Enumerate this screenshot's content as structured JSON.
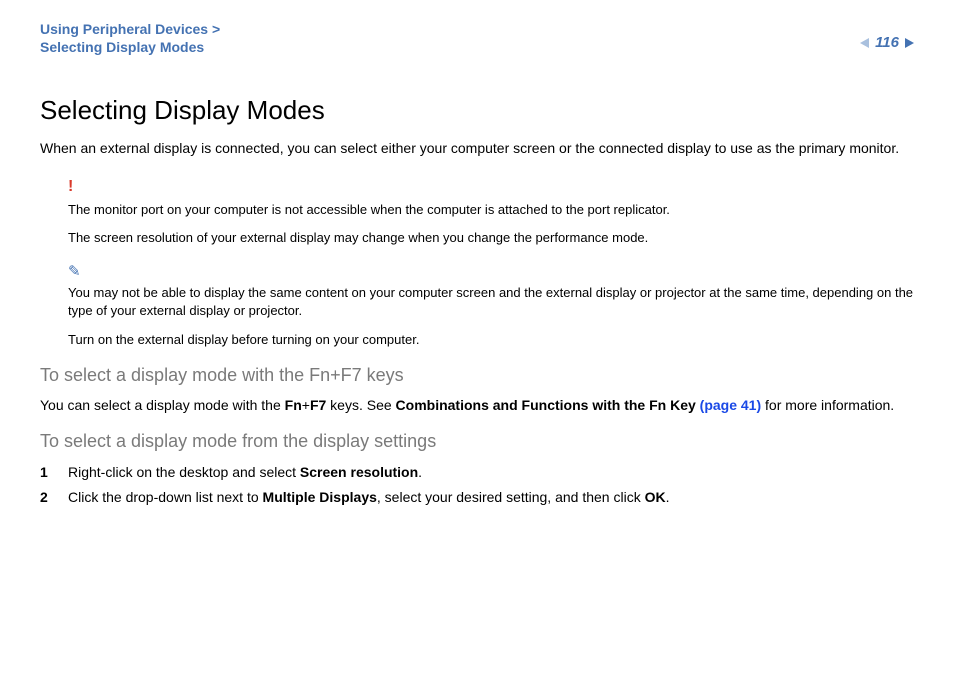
{
  "breadcrumb": {
    "line1": "Using Peripheral Devices >",
    "line2": "Selecting Display Modes"
  },
  "pageNumber": "116",
  "title": "Selecting Display Modes",
  "intro": "When an external display is connected, you can select either your computer screen or the connected display to use as the primary monitor.",
  "caution": {
    "p1": "The monitor port on your computer is not accessible when the computer is attached to the port replicator.",
    "p2": "The screen resolution of your external display may change when you change the performance mode."
  },
  "tip": {
    "p1": "You may not be able to display the same content on your computer screen and the external display or projector at the same time, depending on the type of your external display or projector.",
    "p2": "Turn on the external display before turning on your computer."
  },
  "section1": {
    "heading": "To select a display mode with the Fn+F7 keys",
    "text_pre": "You can select a display mode with the ",
    "fn": "Fn",
    "plus": "+",
    "f7": "F7",
    "text_mid": " keys. See ",
    "link_bold": "Combinations and Functions with the Fn Key ",
    "link_page": "(page 41)",
    "text_post": " for more information."
  },
  "section2": {
    "heading": "To select a display mode from the display settings",
    "steps": [
      {
        "n": "1",
        "pre": "Right-click on the desktop and select ",
        "bold": "Screen resolution",
        "post": "."
      },
      {
        "n": "2",
        "pre": "Click the drop-down list next to ",
        "bold": "Multiple Displays",
        "post": ", select your desired setting, and then click ",
        "bold2": "OK",
        "post2": "."
      }
    ]
  }
}
